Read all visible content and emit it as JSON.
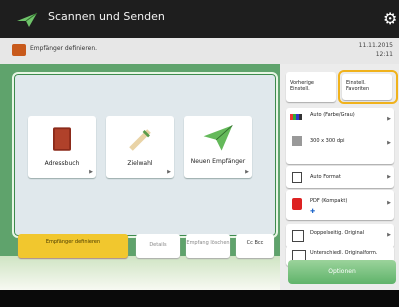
{
  "header": {
    "title": "Scannen und Senden",
    "gear_icon": "gear-icon",
    "app_icon": "scanner-plane-icon"
  },
  "message": {
    "text": "Empfänger definieren.",
    "date": "11.11.2015",
    "time": "12:11"
  },
  "tiles": [
    {
      "label": "Adressbuch",
      "icon": "book-icon"
    },
    {
      "label": "Zielwahl",
      "icon": "hand-pen-icon"
    },
    {
      "label": "Neuen Empfänger",
      "icon": "paper-plane-icon"
    }
  ],
  "bottom_buttons": {
    "primary": "Empfänger definieren",
    "details": "Details",
    "delete": "Empfang löschen",
    "cc_bcc": "Cc Bcc"
  },
  "right_panel": {
    "top_left": "Vorherige Einstell.",
    "top_right": "Einstell. Favoriten",
    "color_mode": "Auto (Farbe/Grau)",
    "resolution": "300 x 300 dpi",
    "scan_size": "Auto Format",
    "file_format": "PDF (Kompakt)",
    "duplex": "Doppelseitig. Original",
    "mixed": "Unterschiedl. Originalform.",
    "options": "Optionen"
  },
  "colors": {
    "accent_green": "#5fa36c",
    "yellow": "#f1c72e",
    "highlight": "#f0b21c"
  }
}
